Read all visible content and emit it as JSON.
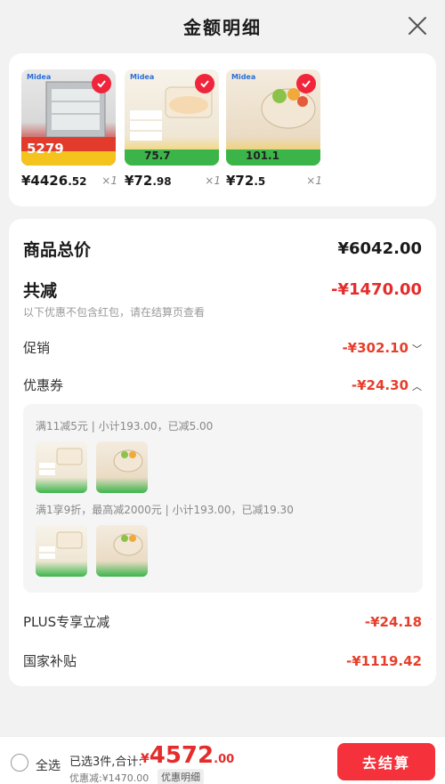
{
  "header": {
    "title": "金额明细"
  },
  "products": [
    {
      "name": "dishwasher",
      "price_int": "¥4426",
      "price_dec": ".52",
      "qty": "×1",
      "brand": "Midea",
      "promo": "5279"
    },
    {
      "name": "egg-steamer",
      "price_int": "¥72",
      "price_dec": ".98",
      "qty": "×1",
      "brand": "Midea",
      "promo": "75.7"
    },
    {
      "name": "multi-cooker",
      "price_int": "¥72",
      "price_dec": ".5",
      "qty": "×1",
      "brand": "Midea",
      "promo": "101.1"
    }
  ],
  "summary": {
    "goods_total_label": "商品总价",
    "goods_total": "¥6042.00",
    "reduce_label": "共减",
    "reduce_total": "-¥1470.00",
    "reduce_note": "以下优惠不包含红包，请在结算页查看",
    "promo_label": "促销",
    "promo_amount": "-¥302.10",
    "coupon_label": "优惠券",
    "coupon_amount": "-¥24.30",
    "coupon_detail_1": "满11减5元 | 小计193.00，已减5.00",
    "coupon_detail_2": "满1享9折，最高减2000元 | 小计193.00，已减19.30",
    "plus_label": "PLUS专享立减",
    "plus_amount": "-¥24.18",
    "subsidy_label": "国家补贴",
    "subsidy_amount": "-¥1119.42"
  },
  "bottom": {
    "select_all": "全选",
    "selected_info": "已选3件,合计:",
    "total_cur": "¥",
    "total_int": "4572",
    "total_dec": ".00",
    "discount_text": "优惠减:¥1470.00",
    "detail_label": "优惠明细",
    "checkout_label": "去结算"
  },
  "colors": {
    "accent": "#f5323b",
    "price_red": "#e52c2c"
  }
}
